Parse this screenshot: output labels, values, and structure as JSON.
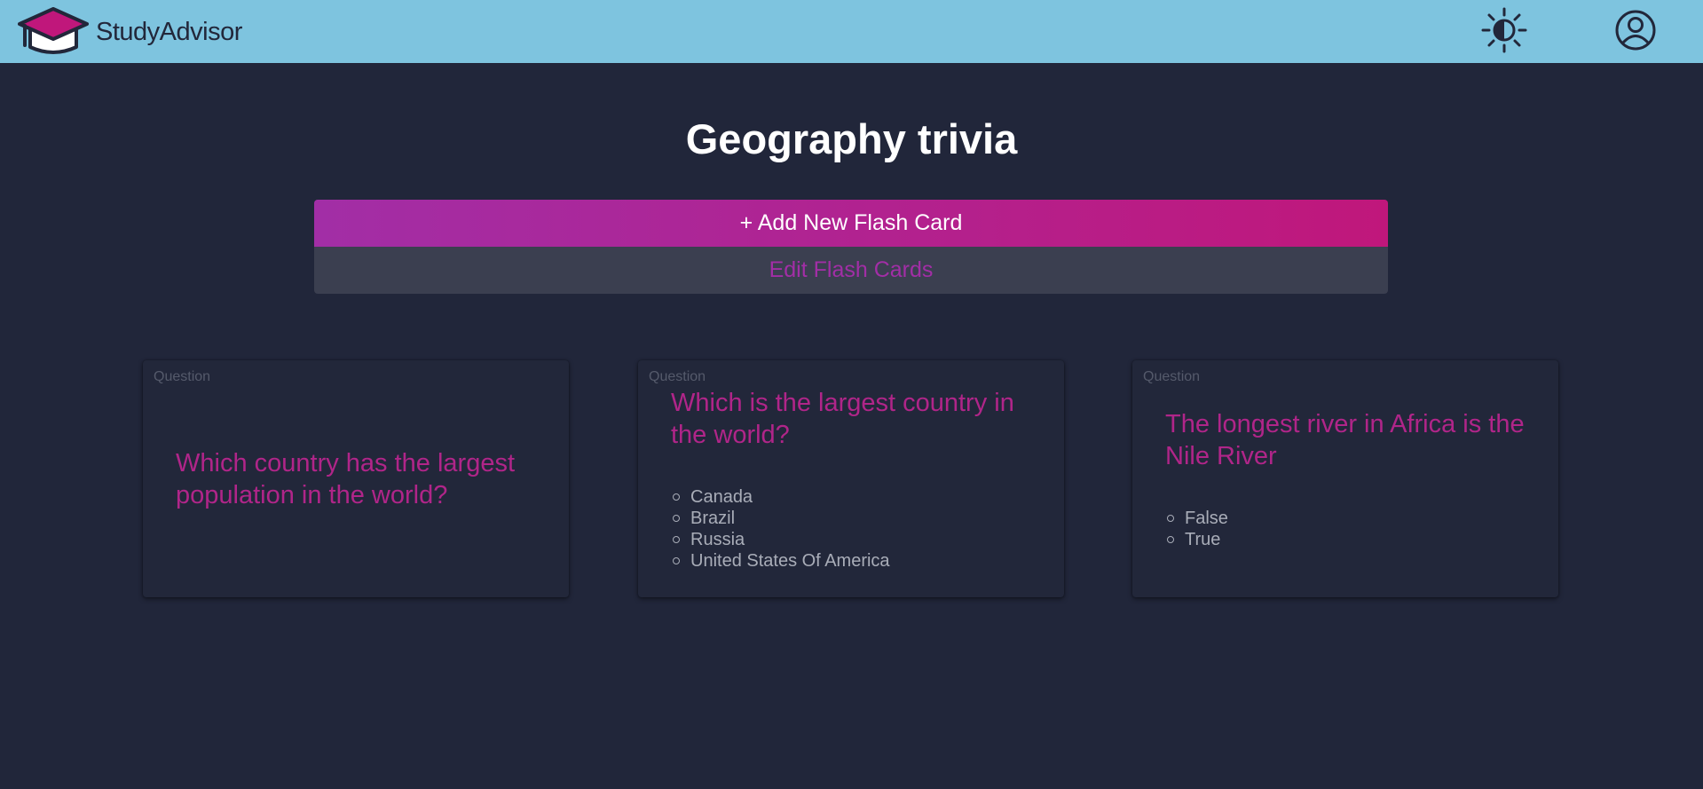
{
  "header": {
    "brand_name": "StudyAdvisor",
    "logo_icon": "graduation-cap-icon",
    "theme_icon": "contrast-sun-icon",
    "account_icon": "user-circle-icon",
    "bar_color": "#7ec4df"
  },
  "main": {
    "title": "Geography trivia",
    "add_button_label": "+ Add New Flash Card",
    "edit_button_label": "Edit Flash Cards",
    "accent_gradient": [
      "#a22ea6",
      "#c0177b"
    ]
  },
  "cards": [
    {
      "label": "Question",
      "question": "Which country has the largest population in the world?",
      "options": []
    },
    {
      "label": "Question",
      "question": "Which is the largest country in the world?",
      "options": [
        "Canada",
        "Brazil",
        "Russia",
        "United States Of America"
      ]
    },
    {
      "label": "Question",
      "question": "The longest river in Africa is the Nile River",
      "options": [
        "False",
        "True"
      ]
    }
  ]
}
